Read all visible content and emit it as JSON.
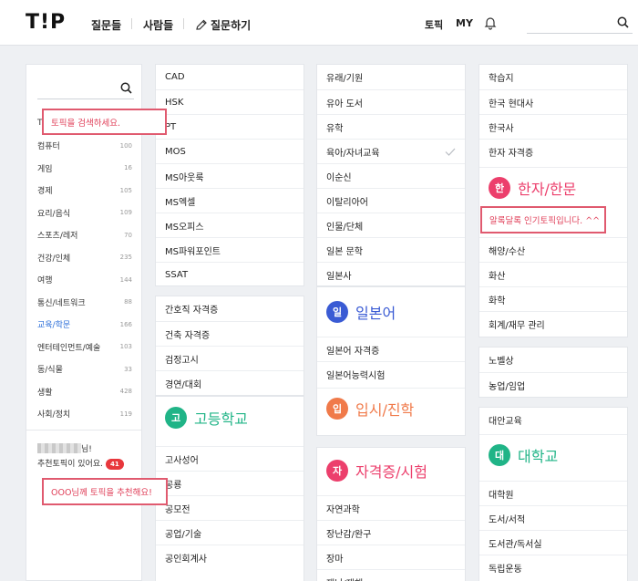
{
  "header": {
    "logo": "T!P",
    "nav": [
      "질문들",
      "사람들",
      "질문하기"
    ],
    "right": [
      "토픽",
      "MY"
    ],
    "search_placeholder": ""
  },
  "left": {
    "search_placeholder": "",
    "items": [
      {
        "label": "T",
        "count": ""
      },
      {
        "label": "컴퓨터",
        "count": "100"
      },
      {
        "label": "게임",
        "count": "16"
      },
      {
        "label": "경제",
        "count": "105"
      },
      {
        "label": "요리/음식",
        "count": "109"
      },
      {
        "label": "스포츠/레저",
        "count": "70"
      },
      {
        "label": "건강/인체",
        "count": "235"
      },
      {
        "label": "여행",
        "count": "144"
      },
      {
        "label": "통신/네트워크",
        "count": "88"
      },
      {
        "label": "교육/학문",
        "count": "166"
      },
      {
        "label": "엔터테인먼트/예술",
        "count": "103"
      },
      {
        "label": "동/식물",
        "count": "33"
      },
      {
        "label": "생활",
        "count": "428"
      },
      {
        "label": "사회/정치",
        "count": "119"
      }
    ],
    "user_suffix": "님!",
    "recommend_text": "추천토픽이 있어요.",
    "recommend_count": "41"
  },
  "tooltips": {
    "search": "토픽을 검색하세요.",
    "popular": "알록달록 인기토픽입니다. ^^",
    "recommend": "OOO님께 토픽을 추천해요!"
  },
  "col1": {
    "group1": [
      "CAD",
      "HSK",
      "PT",
      "MOS",
      "MS아웃룩",
      "MS엑셀",
      "MS오피스",
      "MS파워포인트",
      "SSAT"
    ],
    "group2": [
      "간호직 자격증",
      "건축 자격증",
      "검정고시",
      "경연/대회"
    ],
    "heading": {
      "letter": "고",
      "title": "고등학교"
    },
    "group3": [
      "고사성어",
      "공룡",
      "공모전",
      "공업/기술",
      "공인회계사"
    ]
  },
  "col2": {
    "group1": [
      "유래/기원",
      "유아 도서",
      "유학",
      "육아/자녀교육",
      "이순신",
      "이탈리아어",
      "인물/단체",
      "일본 문학",
      "일본사"
    ],
    "heading1": {
      "letter": "일",
      "title": "일본어"
    },
    "group2": [
      "일본어 자격증",
      "일본어능력시험"
    ],
    "heading2": {
      "letter": "입",
      "title": "입시/진학"
    },
    "heading3": {
      "letter": "자",
      "title": "자격증/시험"
    },
    "group3": [
      "자연과학",
      "장난감/완구",
      "장마",
      "재난/재해"
    ]
  },
  "col3": {
    "group1": [
      "학습지",
      "한국 현대사",
      "한국사",
      "한자 자격증"
    ],
    "heading1": {
      "letter": "한",
      "title": "한자/한문"
    },
    "group2": [
      "해양/수산",
      "화산",
      "화학",
      "회계/재무 관리"
    ],
    "group3": [
      "노벨상",
      "농업/임업"
    ],
    "group4": [
      "대안교육"
    ],
    "heading2": {
      "letter": "대",
      "title": "대학교"
    },
    "group5": [
      "대학원",
      "도서/서적",
      "도서관/독서실",
      "독립운동"
    ]
  },
  "colors": {
    "blue": "#3a5bd4",
    "orange": "#f07a4a",
    "pink": "#ec3f6c",
    "green": "#20b487",
    "tooltip_border": "#e05a6f",
    "active": "#2d6fd9"
  }
}
